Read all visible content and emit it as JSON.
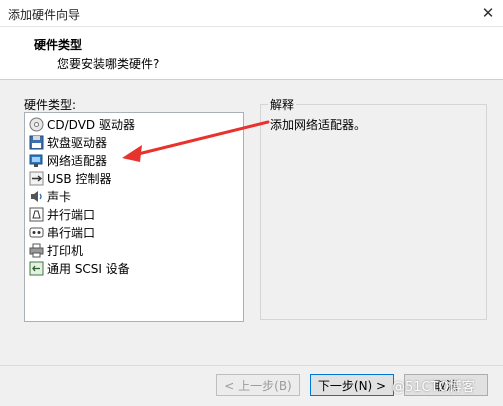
{
  "window": {
    "title": "添加硬件向导",
    "close_glyph": "✕"
  },
  "header": {
    "title": "硬件类型",
    "subtitle": "您要安装哪类硬件?"
  },
  "list": {
    "label": "硬件类型:",
    "items": [
      {
        "label": "CD/DVD 驱动器",
        "icon": "cd-dvd-icon"
      },
      {
        "label": "软盘驱动器",
        "icon": "floppy-icon"
      },
      {
        "label": "网络适配器",
        "icon": "network-adapter-icon"
      },
      {
        "label": "USB 控制器",
        "icon": "usb-icon"
      },
      {
        "label": "声卡",
        "icon": "sound-card-icon"
      },
      {
        "label": "并行端口",
        "icon": "parallel-port-icon"
      },
      {
        "label": "串行端口",
        "icon": "serial-port-icon"
      },
      {
        "label": "打印机",
        "icon": "printer-icon"
      },
      {
        "label": "通用 SCSI 设备",
        "icon": "scsi-icon"
      }
    ]
  },
  "description": {
    "label": "解释",
    "text": "添加网络适配器。"
  },
  "footer": {
    "back_label": "< 上一步(B)",
    "next_label": "下一步(N) >",
    "cancel_label": "取消"
  },
  "watermark": "@51CTO博客",
  "annotation": {
    "arrow_color": "#e8322c"
  }
}
